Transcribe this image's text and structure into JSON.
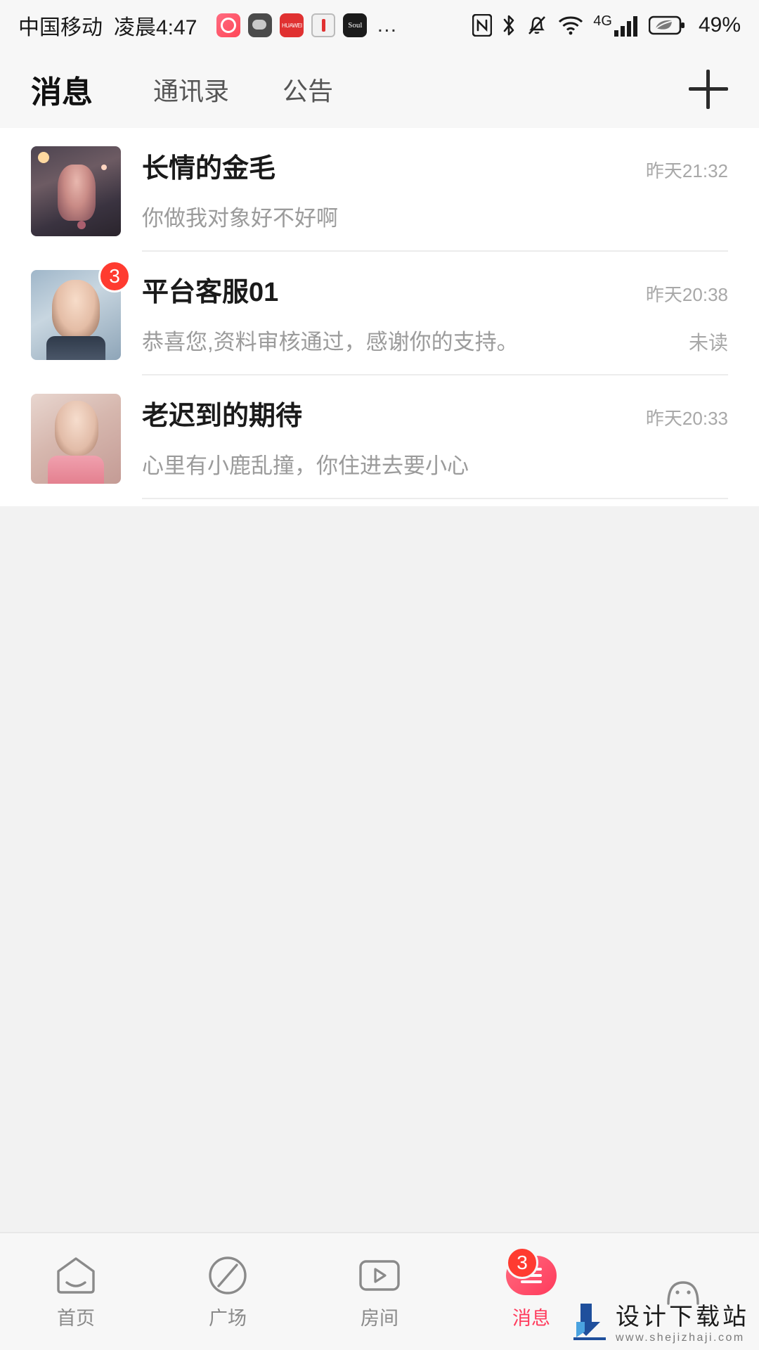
{
  "status_bar": {
    "carrier": "中国移动",
    "time": "凌晨4:47",
    "app_icons": [
      "red-circle-app-icon",
      "wechat-app-icon",
      "huawei-app-icon",
      "note-app-icon",
      "soul-app-icon"
    ],
    "huawei_label": "HUAWEI",
    "soul_label": "Soul",
    "overflow": "…",
    "network_type": "4G",
    "battery_percent": "49%",
    "icons": [
      "nfc-icon",
      "bluetooth-icon",
      "mute-bell-icon",
      "wifi-icon",
      "signal-icon",
      "battery-icon"
    ]
  },
  "header": {
    "tabs": [
      {
        "label": "消息",
        "active": true
      },
      {
        "label": "通讯录",
        "active": false
      },
      {
        "label": "公告",
        "active": false
      }
    ],
    "add_button": "plus-icon"
  },
  "conversations": [
    {
      "avatar": "avatar-long-qing-de-jin-mao",
      "name": "长情的金毛",
      "time": "昨天21:32",
      "message": "你做我对象好不好啊",
      "badge": "",
      "status": ""
    },
    {
      "avatar": "avatar-ping-tai-ke-fu-01",
      "name": "平台客服01",
      "time": "昨天20:38",
      "message": "恭喜您,资料审核通过，感谢你的支持。",
      "badge": "3",
      "status": "未读"
    },
    {
      "avatar": "avatar-lao-chi-dao-de-qi-dai",
      "name": "老迟到的期待",
      "time": "昨天20:33",
      "message": "心里有小鹿乱撞，你住进去要小心",
      "badge": "",
      "status": ""
    }
  ],
  "bottom_nav": [
    {
      "label": "首页",
      "icon": "home-icon",
      "badge": "",
      "active": false
    },
    {
      "label": "广场",
      "icon": "compass-icon",
      "badge": "",
      "active": false
    },
    {
      "label": "房间",
      "icon": "room-video-icon",
      "badge": "",
      "active": false
    },
    {
      "label": "消息",
      "icon": "message-icon",
      "badge": "3",
      "active": true
    },
    {
      "label": "",
      "icon": "profile-icon",
      "badge": "",
      "active": false
    }
  ],
  "watermark": {
    "title": "设计下载站",
    "url": "www.shejizhaji.com"
  },
  "colors": {
    "accent": "#ff3b5c",
    "badge": "#ff3b30",
    "bg": "#f2f2f2",
    "card": "#ffffff",
    "muted": "#9b9b9b"
  }
}
